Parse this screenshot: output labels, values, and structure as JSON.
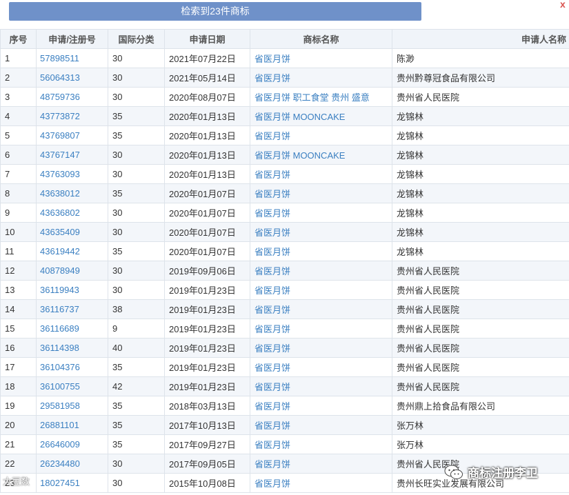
{
  "search": {
    "button_label": "检索到23件商标",
    "close_glyph": "x"
  },
  "table": {
    "headers": [
      "序号",
      "申请/注册号",
      "国际分类",
      "申请日期",
      "商标名称",
      "申请人名称"
    ],
    "rows": [
      [
        "1",
        "57898511",
        "30",
        "2021年07月22日",
        "省医月饼",
        "陈渺"
      ],
      [
        "2",
        "56064313",
        "30",
        "2021年05月14日",
        "省医月饼",
        "贵州黔尊冠食品有限公司"
      ],
      [
        "3",
        "48759736",
        "30",
        "2020年08月07日",
        "省医月饼 职工食堂 贵州 盛意",
        "贵州省人民医院"
      ],
      [
        "4",
        "43773872",
        "35",
        "2020年01月13日",
        "省医月饼 MOONCAKE",
        "龙锦林"
      ],
      [
        "5",
        "43769807",
        "35",
        "2020年01月13日",
        "省医月饼",
        "龙锦林"
      ],
      [
        "6",
        "43767147",
        "30",
        "2020年01月13日",
        "省医月饼 MOONCAKE",
        "龙锦林"
      ],
      [
        "7",
        "43763093",
        "30",
        "2020年01月13日",
        "省医月饼",
        "龙锦林"
      ],
      [
        "8",
        "43638012",
        "35",
        "2020年01月07日",
        "省医月饼",
        "龙锦林"
      ],
      [
        "9",
        "43636802",
        "30",
        "2020年01月07日",
        "省医月饼",
        "龙锦林"
      ],
      [
        "10",
        "43635409",
        "30",
        "2020年01月07日",
        "省医月饼",
        "龙锦林"
      ],
      [
        "11",
        "43619442",
        "35",
        "2020年01月07日",
        "省医月饼",
        "龙锦林"
      ],
      [
        "12",
        "40878949",
        "30",
        "2019年09月06日",
        "省医月饼",
        "贵州省人民医院"
      ],
      [
        "13",
        "36119943",
        "30",
        "2019年01月23日",
        "省医月饼",
        "贵州省人民医院"
      ],
      [
        "14",
        "36116737",
        "38",
        "2019年01月23日",
        "省医月饼",
        "贵州省人民医院"
      ],
      [
        "15",
        "36116689",
        "9",
        "2019年01月23日",
        "省医月饼",
        "贵州省人民医院"
      ],
      [
        "16",
        "36114398",
        "40",
        "2019年01月23日",
        "省医月饼",
        "贵州省人民医院"
      ],
      [
        "17",
        "36104376",
        "35",
        "2019年01月23日",
        "省医月饼",
        "贵州省人民医院"
      ],
      [
        "18",
        "36100755",
        "42",
        "2019年01月23日",
        "省医月饼",
        "贵州省人民医院"
      ],
      [
        "19",
        "29581958",
        "35",
        "2018年03月13日",
        "省医月饼",
        "贵州鼎上拾食品有限公司"
      ],
      [
        "20",
        "26881101",
        "35",
        "2017年10月13日",
        "省医月饼",
        "张万林"
      ],
      [
        "21",
        "26646009",
        "35",
        "2017年09月27日",
        "省医月饼",
        "张万林"
      ],
      [
        "22",
        "26234480",
        "30",
        "2017年09月05日",
        "省医月饼",
        "贵州省人民医院"
      ],
      [
        "23",
        "18027451",
        "30",
        "2015年10月08日",
        "省医月饼",
        "贵州长旺实业发展有限公司"
      ]
    ]
  },
  "watermarks": {
    "left": "大豆数",
    "right": "商标注册李卫"
  },
  "colors": {
    "button": "#6f91c9",
    "link": "#3a7fc1",
    "header_bg": "#f0f4f9",
    "row_alt": "#f3f6fa"
  }
}
